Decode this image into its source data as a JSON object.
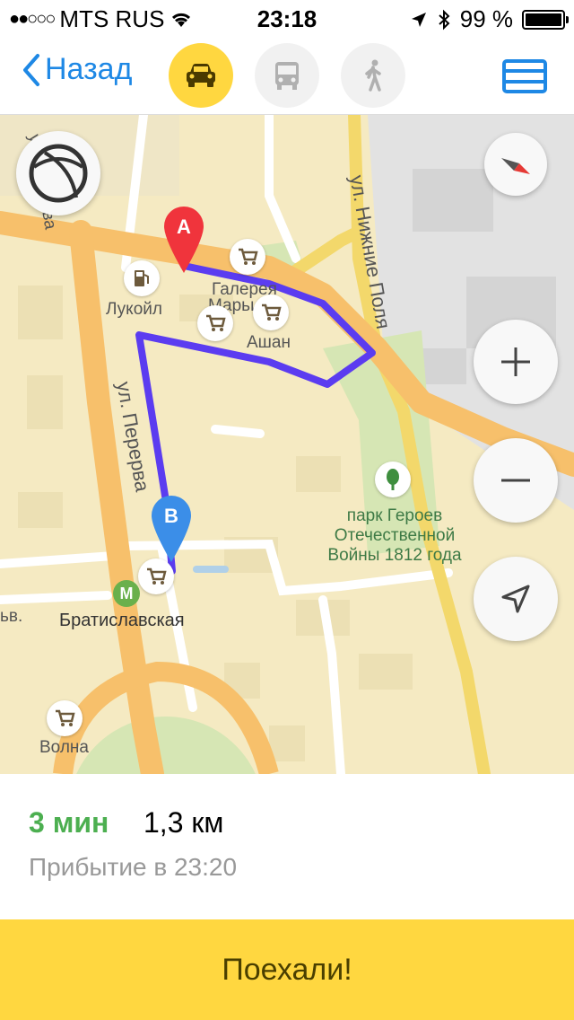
{
  "status_bar": {
    "signal_dots": "●●○○○",
    "carrier": "MTS RUS",
    "time": "23:18",
    "battery": "99 %",
    "battery_level": 0.99
  },
  "nav": {
    "back_label": "Назад",
    "modes": [
      {
        "id": "car",
        "icon": "car-icon",
        "active": true
      },
      {
        "id": "bus",
        "icon": "bus-icon",
        "active": false
      },
      {
        "id": "walk",
        "icon": "walk-icon",
        "active": false
      }
    ],
    "menu_icon": "route-list-icon"
  },
  "map": {
    "streets": {
      "perer_va_top": "ул. Перерва",
      "perer_va": "ул. Перерва",
      "nizhnie_polya": "ул. Нижние Поля",
      "lyublino_fragment": "ьв."
    },
    "places": {
      "lukoil": "Лукойл",
      "galereya": "Галерея",
      "marino": "Марьино",
      "ashan": "Ашан",
      "bratislavskaya": "Братиславская",
      "volna": "Волна"
    },
    "park": {
      "line1": "парк Героев",
      "line2": "Отечественной",
      "line3": "Войны 1812 года"
    },
    "markers": {
      "start": "A",
      "end": "B"
    },
    "metro_letter": "M",
    "colors": {
      "route": "#5b3cf0",
      "marker_a": "#f0343c",
      "marker_b": "#3b8ee8",
      "metro": "#6ab04c",
      "major_road": "#f7c06b",
      "yellow_road": "#f3d86b",
      "park": "#d6e6b4"
    }
  },
  "route_info": {
    "duration": "3 мин",
    "distance": "1,3 км",
    "arrival": "Прибытие в 23:20"
  },
  "go_button": "Поехали!",
  "colors": {
    "accent_blue": "#1e88e5",
    "yellow": "#ffd740",
    "green": "#4caf50"
  }
}
